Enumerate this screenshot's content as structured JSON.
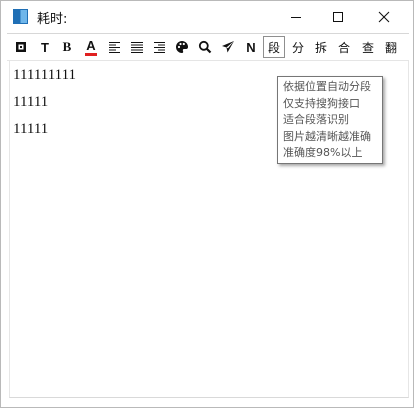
{
  "window": {
    "title": "耗时:"
  },
  "titlebar_buttons": {
    "minimize": "minimize-icon",
    "maximize": "maximize-icon",
    "close": "close-icon"
  },
  "toolbar": {
    "buttons": [
      {
        "name": "square-icon"
      },
      {
        "name": "bold-t-icon",
        "label": "T"
      },
      {
        "name": "serif-b-icon",
        "label": "B"
      },
      {
        "name": "font-color-icon",
        "label": "A"
      },
      {
        "name": "align-left-icon"
      },
      {
        "name": "align-justify-icon"
      },
      {
        "name": "align-right-icon"
      },
      {
        "name": "palette-icon"
      },
      {
        "name": "search-icon"
      },
      {
        "name": "send-icon"
      },
      {
        "name": "n-icon",
        "label": "N"
      },
      {
        "name": "segment-button",
        "label": "段",
        "selected": true
      },
      {
        "name": "split-button",
        "label": "分"
      },
      {
        "name": "break-button",
        "label": "拆"
      },
      {
        "name": "merge-button",
        "label": "合"
      },
      {
        "name": "check-button",
        "label": "查"
      },
      {
        "name": "translate-button",
        "label": "翻"
      }
    ]
  },
  "content": {
    "lines": [
      "111111111",
      "11111",
      "11111"
    ]
  },
  "tooltip": {
    "lines": [
      "依据位置自动分段",
      "仅支持搜狗接口",
      "适合段落识别",
      "图片越清晰越准确",
      "准确度98%以上"
    ]
  },
  "colors": {
    "font_color_underline": "#e02020",
    "app_icon": "#1f6fb5"
  }
}
